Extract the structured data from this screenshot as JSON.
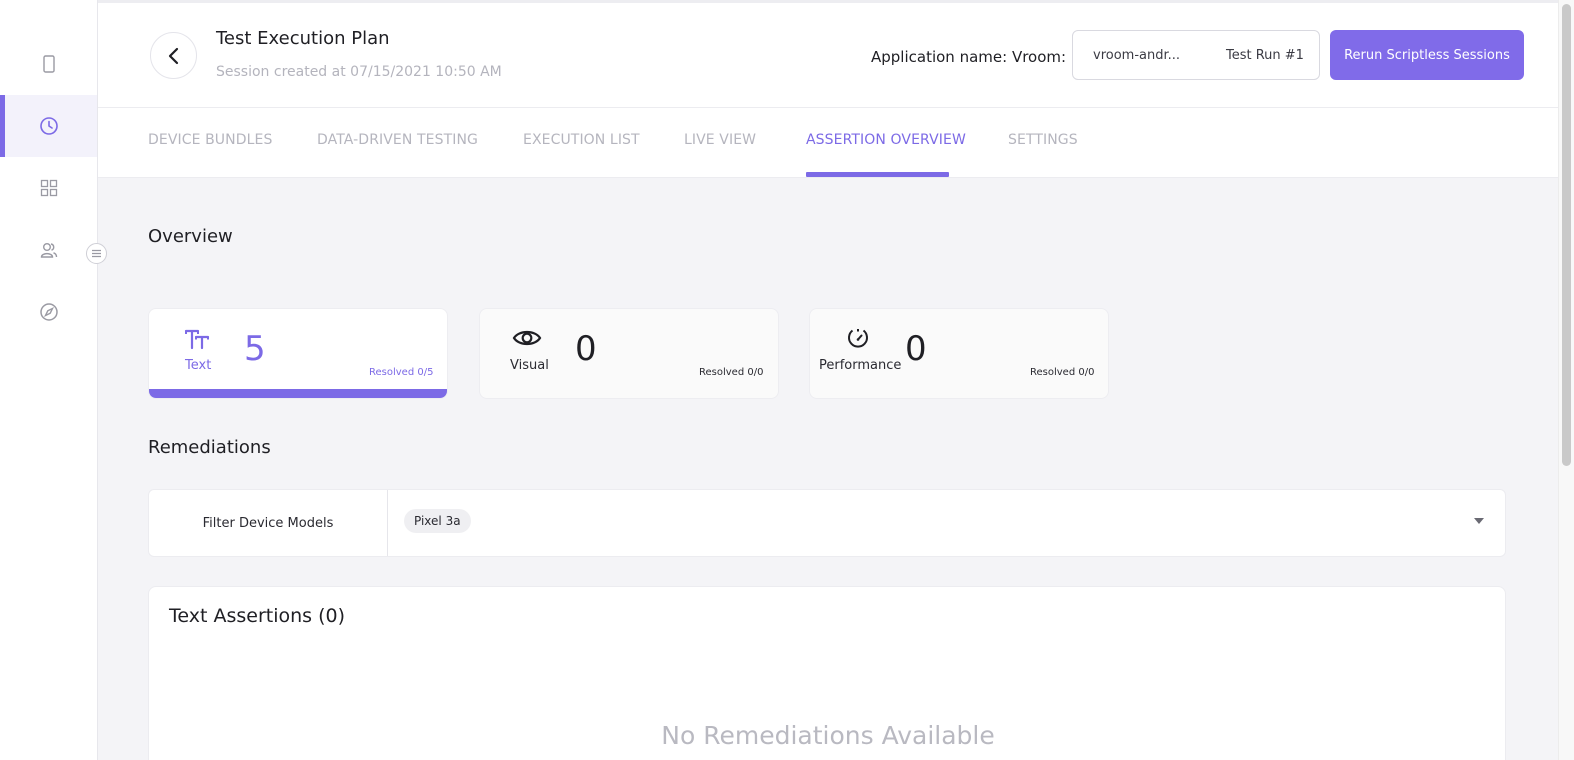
{
  "header": {
    "title": "Test Execution Plan",
    "subtitle": "Session created at 07/15/2021 10:50 AM",
    "app_label": "Application name: Vroom:",
    "app_select": {
      "app": "vroom-andr...",
      "run": "Test Run #1"
    },
    "rerun_button": "Rerun Scriptless Sessions"
  },
  "sidebar": {
    "items": [
      {
        "icon": "device-icon",
        "active": false
      },
      {
        "icon": "clock-icon",
        "active": true
      },
      {
        "icon": "grid-icon",
        "active": false
      },
      {
        "icon": "users-icon",
        "active": false
      },
      {
        "icon": "compass-icon",
        "active": false
      }
    ]
  },
  "tabs": [
    {
      "label": "DEVICE BUNDLES",
      "active": false
    },
    {
      "label": "DATA-DRIVEN TESTING",
      "active": false
    },
    {
      "label": "EXECUTION LIST",
      "active": false
    },
    {
      "label": "LIVE VIEW",
      "active": false
    },
    {
      "label": "ASSERTION OVERVIEW",
      "active": true
    },
    {
      "label": "SETTINGS",
      "active": false
    }
  ],
  "overview": {
    "title": "Overview",
    "cards": [
      {
        "icon": "text-icon",
        "label": "Text",
        "count": "5",
        "resolved": "Resolved 0/5",
        "active": true
      },
      {
        "icon": "eye-icon",
        "label": "Visual",
        "count": "0",
        "resolved": "Resolved 0/0",
        "active": false
      },
      {
        "icon": "gauge-icon",
        "label": "Performance",
        "count": "0",
        "resolved": "Resolved 0/0",
        "active": false
      }
    ]
  },
  "remediations": {
    "title": "Remediations",
    "filter_label": "Filter Device Models",
    "selected_models": [
      "Pixel 3a"
    ]
  },
  "assertions": {
    "title": "Text Assertions (0)",
    "empty_message": "No Remediations Available"
  },
  "colors": {
    "accent": "#7c6ae6",
    "button": "#806be9",
    "background": "#f4f4f7",
    "muted_text": "#b5b5be"
  }
}
